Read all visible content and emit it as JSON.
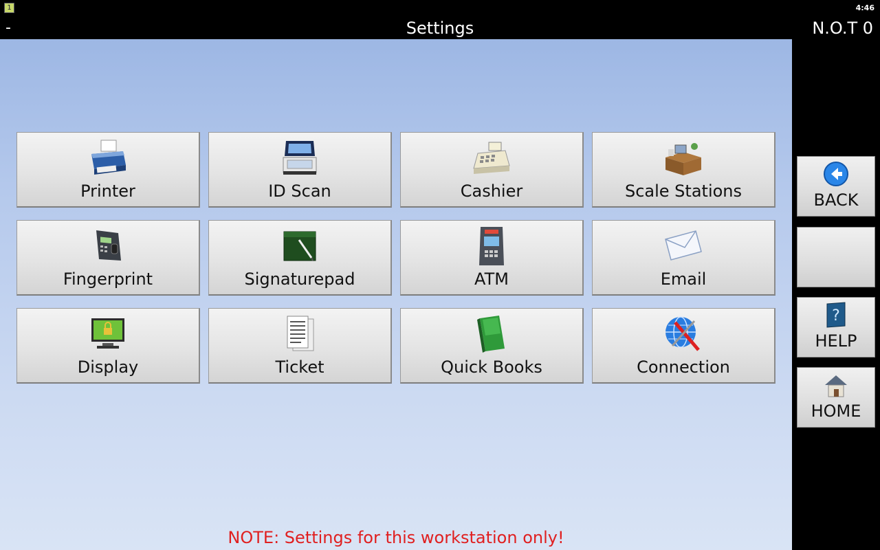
{
  "status": {
    "notification": "1",
    "time": "4:46"
  },
  "titlebar": {
    "left": "-",
    "title": "Settings",
    "right": "N.O.T 0"
  },
  "tiles": [
    {
      "label": "Printer",
      "icon": "printer-icon"
    },
    {
      "label": "ID Scan",
      "icon": "scanner-icon"
    },
    {
      "label": "Cashier",
      "icon": "cash-register-icon"
    },
    {
      "label": "Scale Stations",
      "icon": "workstation-desk-icon"
    },
    {
      "label": "Fingerprint",
      "icon": "fingerprint-reader-icon"
    },
    {
      "label": "Signaturepad",
      "icon": "signature-pad-icon"
    },
    {
      "label": "ATM",
      "icon": "atm-icon"
    },
    {
      "label": "Email",
      "icon": "envelope-icon"
    },
    {
      "label": "Display",
      "icon": "monitor-lock-icon"
    },
    {
      "label": "Ticket",
      "icon": "document-icon"
    },
    {
      "label": "Quick Books",
      "icon": "green-book-icon"
    },
    {
      "label": "Connection",
      "icon": "globe-tools-icon"
    }
  ],
  "note": "NOTE: Settings for this workstation only!",
  "side": {
    "back": "BACK",
    "blank": "",
    "help": "HELP",
    "home": "HOME"
  },
  "colors": {
    "note": "#e02020",
    "accent": "#2a7de0"
  }
}
